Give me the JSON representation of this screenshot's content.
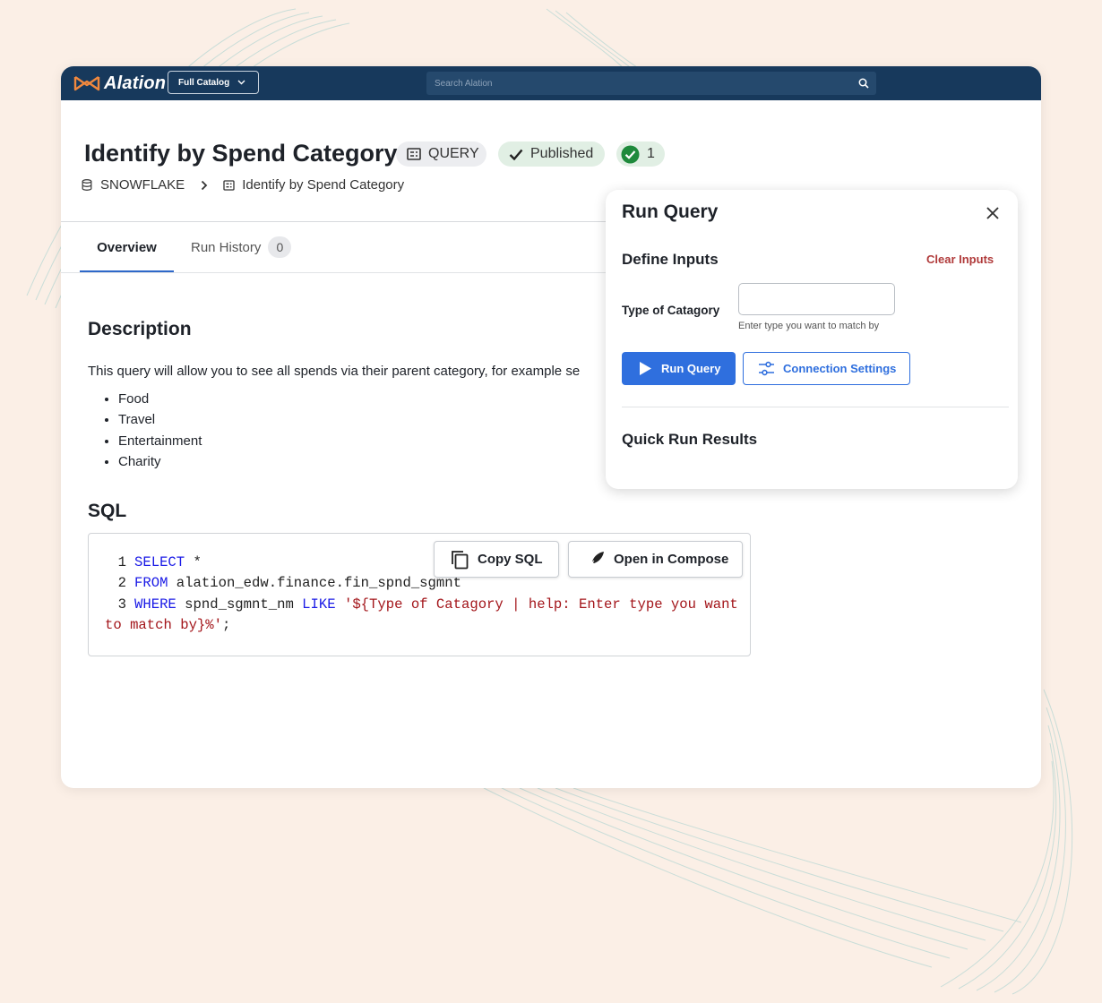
{
  "app": {
    "brand": "Alation",
    "catalog_label": "Full Catalog",
    "search_placeholder": "Search Alation",
    "accent_color": "#17395c",
    "logo_color": "#f0883e"
  },
  "header": {
    "title": "Identify by Spend Category",
    "query_chip": "QUERY",
    "published_chip": "Published",
    "check_count": "1",
    "breadcrumb": {
      "source": "SNOWFLAKE",
      "item": "Identify by Spend Category"
    }
  },
  "tabs": {
    "overview": "Overview",
    "history": "Run History",
    "history_count": "0"
  },
  "description": {
    "heading": "Description",
    "text": "This query will allow you to see all spends via their parent category, for example se",
    "items": [
      "Food",
      "Travel",
      "Entertainment",
      "Charity"
    ]
  },
  "sql": {
    "heading": "SQL",
    "copy_label": "Copy SQL",
    "compose_label": "Open in Compose",
    "line_numbers": [
      "1",
      "2",
      "3"
    ],
    "line1_kw": "SELECT",
    "line1_rest": " *",
    "line2_kw": "FROM",
    "line2_rest": " alation_edw.finance.fin_spnd_sgmnt",
    "line3_kw": "WHERE",
    "line3_mid": " spnd_sgmnt_nm ",
    "line3_kw2": "LIKE",
    "line3_str": " '${Type of Catagory | help: Enter type you want",
    "line4_str": "to match by}%'",
    "line4_end": ";"
  },
  "run_panel": {
    "title": "Run Query",
    "define_heading": "Define Inputs",
    "clear_label": "Clear Inputs",
    "field_label": "Type of Catagory",
    "field_value": "",
    "field_hint": "Enter type you want to match by",
    "run_label": "Run Query",
    "connection_label": "Connection Settings",
    "results_heading": "Quick Run Results"
  }
}
